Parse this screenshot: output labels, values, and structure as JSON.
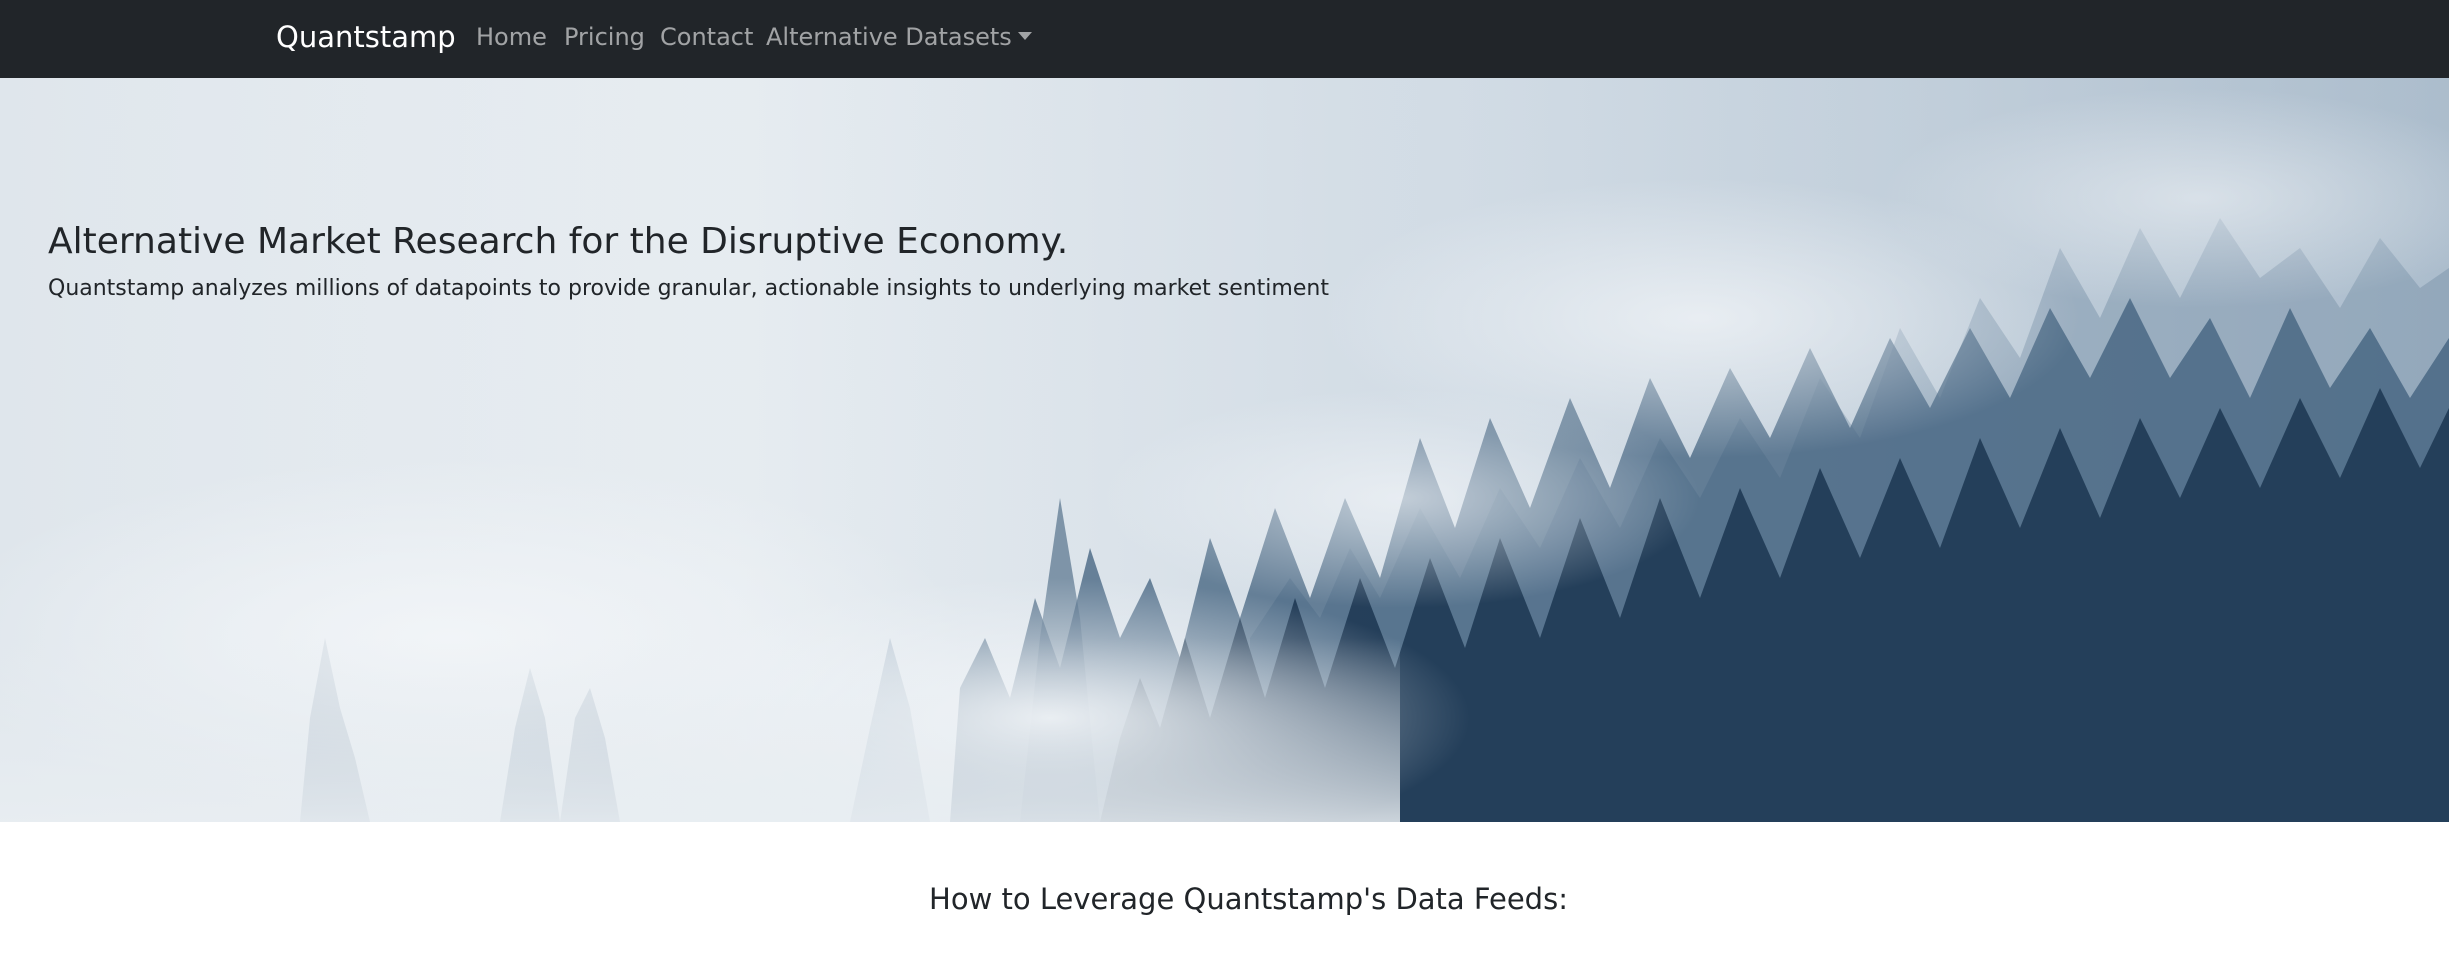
{
  "navbar": {
    "brand": "Quantstamp",
    "links": [
      {
        "label": "Home"
      },
      {
        "label": "Pricing"
      },
      {
        "label": "Contact"
      },
      {
        "label": "Alternative Datasets"
      }
    ]
  },
  "hero": {
    "title": "Alternative Market Research for the Disruptive Economy.",
    "subtitle": "Quantstamp analyzes millions of datapoints to provide granular, actionable insights to underlying market sentiment",
    "image_description_icon": "foggy-forest-image"
  },
  "main": {
    "section_title": "How to Leverage Quantstamp's Data Feeds:"
  },
  "colors": {
    "navbar_bg": "#212529",
    "brand_text": "#ffffff",
    "nav_link_text": "#9a9da0",
    "body_text": "#212529"
  }
}
